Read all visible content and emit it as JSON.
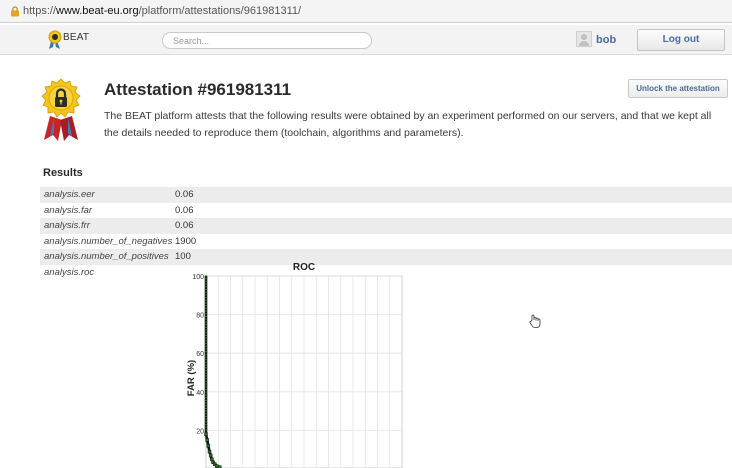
{
  "browser": {
    "url_scheme": "https://",
    "url_host": "www.beat-eu.org",
    "url_path": "/platform/attestations/961981311/"
  },
  "header": {
    "logo_text": "BEAT",
    "search_placeholder": "Search...",
    "username": "bob",
    "logout_label": "Log out"
  },
  "attestation": {
    "title": "Attestation #961981311",
    "description": "The BEAT platform attests that the following results were obtained by an experiment performed on our servers, and that we kept all the details needed to reproduce them (toolchain, algorithms and parameters).",
    "unlock_label": "Unlock the attestation",
    "icons": [
      "padlock-medal-icon"
    ]
  },
  "results": {
    "heading": "Results",
    "rows": [
      {
        "key": "analysis.eer",
        "value": "0.06"
      },
      {
        "key": "analysis.far",
        "value": "0.06"
      },
      {
        "key": "analysis.frr",
        "value": "0.06"
      },
      {
        "key": "analysis.number_of_negatives",
        "value": "1900"
      },
      {
        "key": "analysis.number_of_positives",
        "value": "100"
      }
    ],
    "roc_key": "analysis.roc"
  },
  "chart_data": {
    "type": "line",
    "title": "ROC",
    "ylabel": "FAR (%)",
    "xlabel": "",
    "ylim": [
      0,
      100
    ],
    "yticks": [
      20,
      40,
      60,
      80,
      100
    ],
    "grid": true,
    "series": [
      {
        "x": [
          0,
          0,
          0,
          0.6,
          1.2,
          1.8,
          2.4,
          3.0,
          3.6,
          4.5,
          5.5,
          7.0
        ],
        "y": [
          100,
          60,
          18,
          15,
          12,
          9,
          7,
          5,
          3.5,
          2.5,
          1.5,
          1.0
        ]
      }
    ],
    "xlim": [
      0,
      100
    ],
    "colors": {
      "line": "#111111",
      "marker": "#2e6b2e"
    }
  }
}
